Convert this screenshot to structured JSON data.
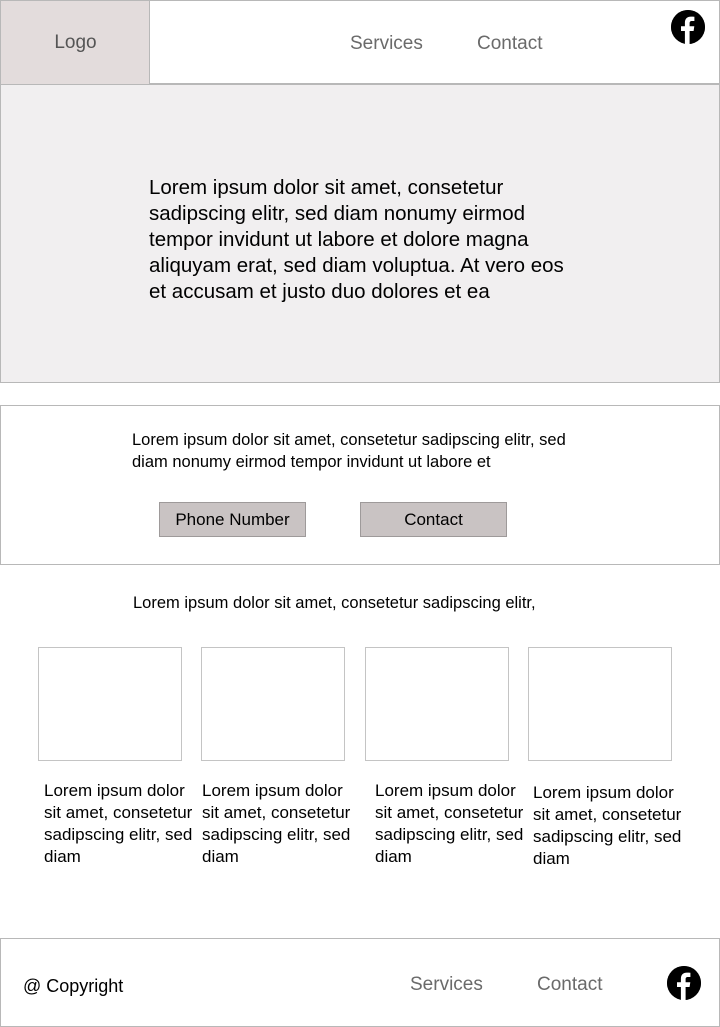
{
  "header": {
    "logo": "Logo",
    "nav": [
      "Services",
      "Contact"
    ],
    "social_icon": "facebook-icon"
  },
  "hero": {
    "text": "Lorem ipsum dolor sit amet, consetetur sadipscing elitr, sed diam nonumy eirmod tempor invidunt ut labore et dolore magna aliquyam erat, sed diam voluptua. At vero eos et accusam et justo duo dolores et ea"
  },
  "contact_band": {
    "text": "Lorem ipsum dolor sit amet, consetetur sadipscing elitr, sed diam nonumy eirmod tempor invidunt ut labore et",
    "phone_button": "Phone Number",
    "contact_button": "Contact"
  },
  "cards_section": {
    "heading": "Lorem ipsum dolor sit amet, consetetur sadipscing elitr,",
    "cards": [
      {
        "text": "Lorem ipsum dolor sit amet, consetetur sadipscing elitr, sed diam"
      },
      {
        "text": "Lorem ipsum dolor sit amet, consetetur sadipscing elitr, sed diam"
      },
      {
        "text": "Lorem ipsum dolor sit amet, consetetur sadipscing elitr, sed diam"
      },
      {
        "text": "Lorem ipsum dolor sit amet, consetetur sadipscing elitr, sed diam"
      }
    ]
  },
  "footer": {
    "copyright": "@ Copyright",
    "nav": [
      "Services",
      "Contact"
    ],
    "social_icon": "facebook-icon"
  },
  "colors": {
    "logo_bg": "#e3dcdc",
    "hero_bg": "#f1eff0",
    "button_bg": "#c9c3c3",
    "nav_text": "#6a6a6a"
  }
}
